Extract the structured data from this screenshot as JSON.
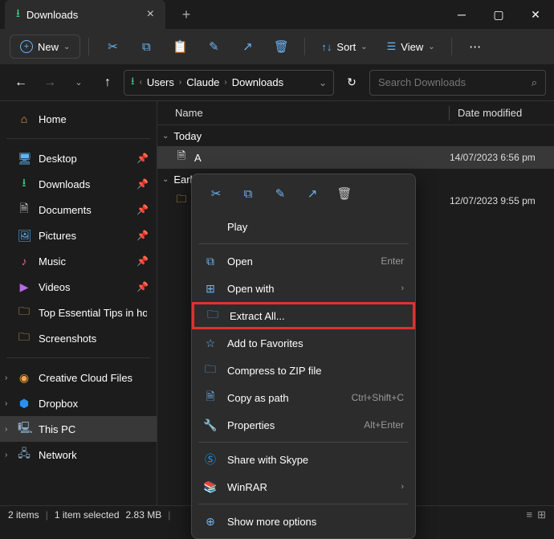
{
  "title": "Downloads",
  "toolbar": {
    "new": "New",
    "sort": "Sort",
    "view": "View"
  },
  "breadcrumbs": [
    "Users",
    "Claude",
    "Downloads"
  ],
  "search_placeholder": "Search Downloads",
  "columns": {
    "name": "Name",
    "date": "Date modified"
  },
  "sidebar": {
    "home": "Home",
    "quick": [
      "Desktop",
      "Downloads",
      "Documents",
      "Pictures",
      "Music",
      "Videos",
      "Top Essential Tips in how to",
      "Screenshots"
    ],
    "drives": [
      "Creative Cloud Files",
      "Dropbox",
      "This PC",
      "Network"
    ]
  },
  "groups": [
    {
      "label": "Today",
      "items": [
        {
          "name": "A",
          "date": "14/07/2023 6:56 pm"
        }
      ]
    },
    {
      "label": "Earlier this week",
      "items": [
        {
          "name": "",
          "date": "12/07/2023 9:55 pm"
        }
      ]
    }
  ],
  "context": {
    "play": "Play",
    "open": "Open",
    "open_hint": "Enter",
    "openwith": "Open with",
    "extract": "Extract All...",
    "fav": "Add to Favorites",
    "zip": "Compress to ZIP file",
    "copypath": "Copy as path",
    "copypath_hint": "Ctrl+Shift+C",
    "props": "Properties",
    "props_hint": "Alt+Enter",
    "skype": "Share with Skype",
    "winrar": "WinRAR",
    "more": "Show more options"
  },
  "status": {
    "count": "2 items",
    "sel": "1 item selected",
    "size": "2.83 MB"
  }
}
